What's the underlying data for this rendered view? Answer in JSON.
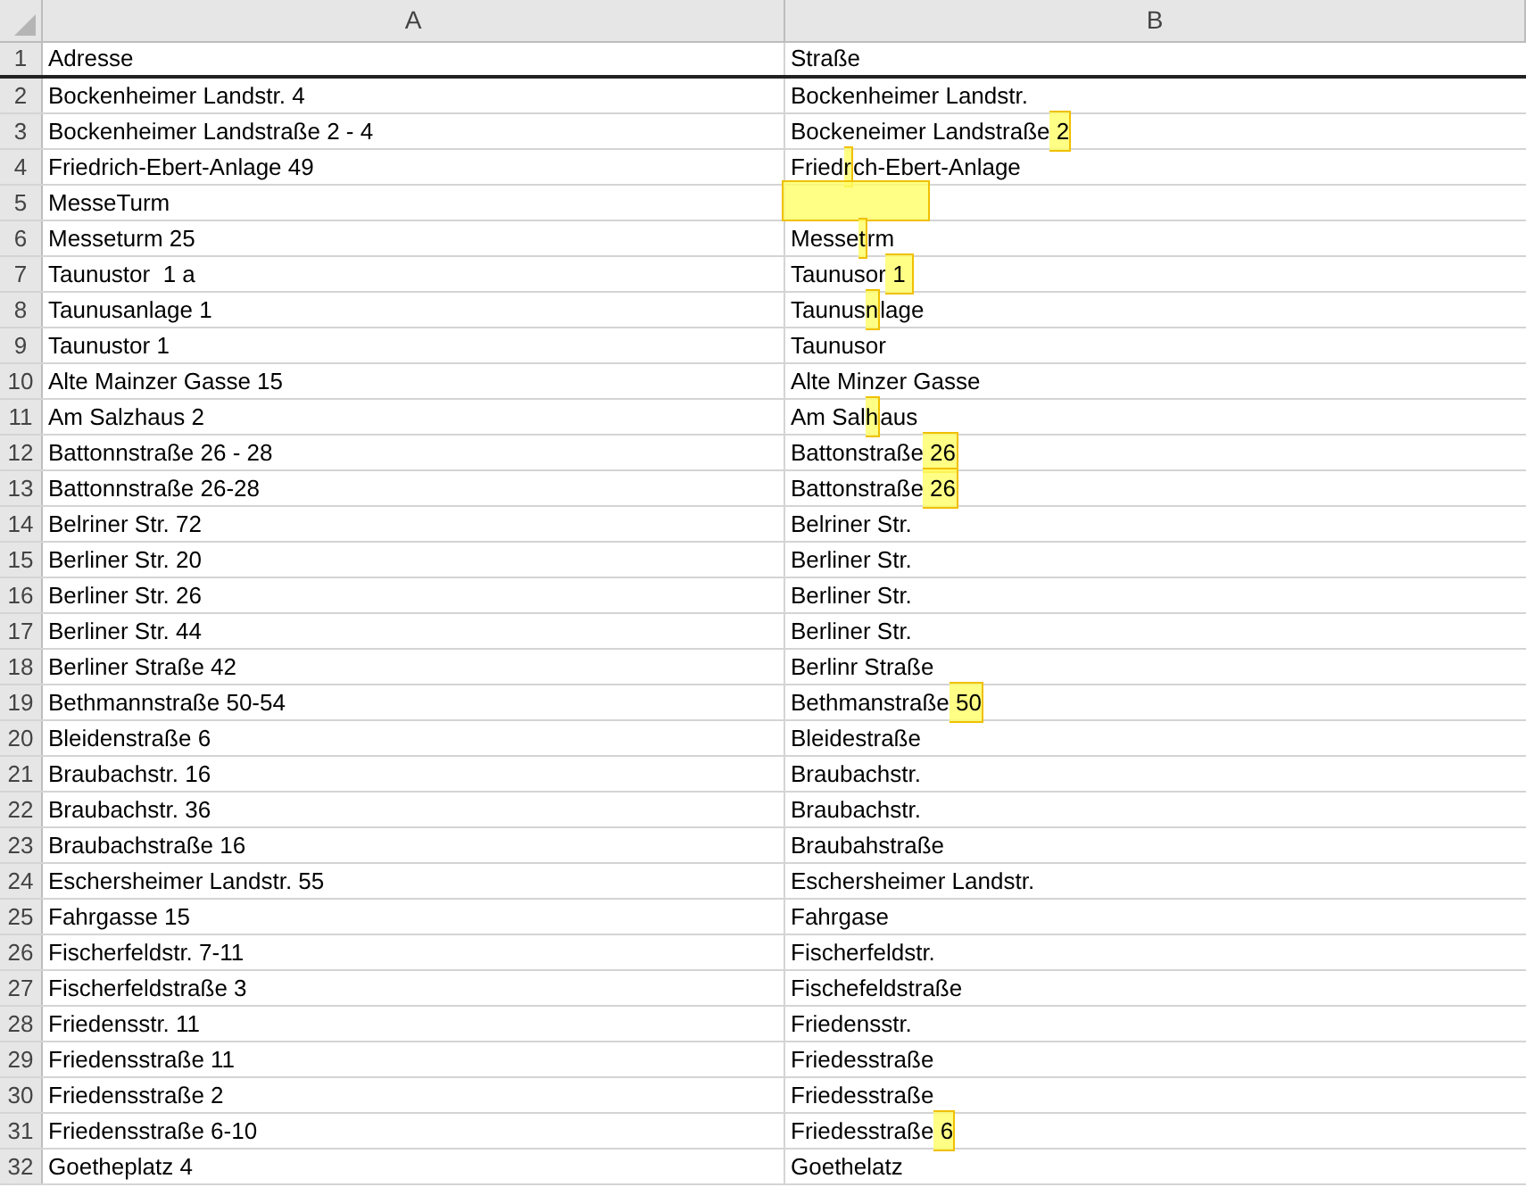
{
  "columns": [
    {
      "label": "A"
    },
    {
      "label": "B"
    }
  ],
  "rows": [
    {
      "n": "1",
      "a": "Adresse",
      "b": [
        {
          "text": "Straße",
          "highlight": false
        }
      ]
    },
    {
      "n": "2",
      "a": "Bockenheimer Landstr. 4",
      "b": [
        {
          "text": "Bockenheimer Landstr.",
          "highlight": false
        }
      ]
    },
    {
      "n": "3",
      "a": "Bockenheimer Landstraße 2 - 4",
      "b": [
        {
          "text": "Bockeneimer Landstraße",
          "highlight": false
        },
        {
          "text": " 2",
          "highlight": true
        }
      ]
    },
    {
      "n": "4",
      "a": "Friedrich-Ebert-Anlage 49",
      "b": [
        {
          "text": "Fried",
          "highlight": false
        },
        {
          "text": "r",
          "highlight": true
        },
        {
          "text": "ch-Ebert-Anlage",
          "highlight": false
        }
      ]
    },
    {
      "n": "5",
      "a": "MesseTurm",
      "b": [
        {
          "kind": "gap",
          "highlight": true
        }
      ]
    },
    {
      "n": "6",
      "a": "Messeturm 25",
      "b": [
        {
          "text": "Messe",
          "highlight": false
        },
        {
          "text": "t",
          "highlight": true
        },
        {
          "text": "rm",
          "highlight": false
        }
      ]
    },
    {
      "n": "7",
      "a": "Taunustor  1 a",
      "b": [
        {
          "text": "Taunusor",
          "highlight": false
        },
        {
          "text": " 1 ",
          "highlight": true
        }
      ]
    },
    {
      "n": "8",
      "a": "Taunusanlage 1",
      "b": [
        {
          "text": "Taunus",
          "highlight": false
        },
        {
          "text": "n",
          "highlight": true
        },
        {
          "text": "lage",
          "highlight": false
        }
      ]
    },
    {
      "n": "9",
      "a": "Taunustor 1",
      "b": [
        {
          "text": "Taunusor",
          "highlight": false
        }
      ]
    },
    {
      "n": "10",
      "a": "Alte Mainzer Gasse 15",
      "b": [
        {
          "text": "Alte Minzer Gasse",
          "highlight": false
        }
      ]
    },
    {
      "n": "11",
      "a": "Am Salzhaus 2",
      "b": [
        {
          "text": "Am Sal",
          "highlight": false
        },
        {
          "text": "h",
          "highlight": true
        },
        {
          "text": "aus",
          "highlight": false
        }
      ]
    },
    {
      "n": "12",
      "a": "Battonnstraße 26 - 28",
      "b": [
        {
          "text": "Battonstraße",
          "highlight": false
        },
        {
          "text": " 26",
          "highlight": true
        }
      ]
    },
    {
      "n": "13",
      "a": "Battonnstraße 26-28",
      "b": [
        {
          "text": "Battonstraße",
          "highlight": false
        },
        {
          "text": " 26",
          "highlight": true
        }
      ]
    },
    {
      "n": "14",
      "a": "Belriner Str. 72",
      "b": [
        {
          "text": "Belriner Str.",
          "highlight": false
        }
      ]
    },
    {
      "n": "15",
      "a": "Berliner Str. 20",
      "b": [
        {
          "text": "Berliner Str.",
          "highlight": false
        }
      ]
    },
    {
      "n": "16",
      "a": "Berliner Str. 26",
      "b": [
        {
          "text": "Berliner Str.",
          "highlight": false
        }
      ]
    },
    {
      "n": "17",
      "a": "Berliner Str. 44",
      "b": [
        {
          "text": "Berliner Str.",
          "highlight": false
        }
      ]
    },
    {
      "n": "18",
      "a": "Berliner Straße 42",
      "b": [
        {
          "text": "Berlinr Straße",
          "highlight": false
        }
      ]
    },
    {
      "n": "19",
      "a": "Bethmannstraße 50-54",
      "b": [
        {
          "text": "Bethmanstraße",
          "highlight": false
        },
        {
          "text": " 50",
          "highlight": true
        }
      ]
    },
    {
      "n": "20",
      "a": "Bleidenstraße 6",
      "b": [
        {
          "text": "Bleidestraße",
          "highlight": false
        }
      ]
    },
    {
      "n": "21",
      "a": "Braubachstr. 16",
      "b": [
        {
          "text": "Braubachstr.",
          "highlight": false
        }
      ]
    },
    {
      "n": "22",
      "a": "Braubachstr. 36",
      "b": [
        {
          "text": "Braubachstr.",
          "highlight": false
        }
      ]
    },
    {
      "n": "23",
      "a": "Braubachstraße 16",
      "b": [
        {
          "text": "Braubahstraße",
          "highlight": false
        }
      ]
    },
    {
      "n": "24",
      "a": "Eschersheimer Landstr. 55",
      "b": [
        {
          "text": "Eschersheimer Landstr.",
          "highlight": false
        }
      ]
    },
    {
      "n": "25",
      "a": "Fahrgasse 15",
      "b": [
        {
          "text": "Fahrgase",
          "highlight": false
        }
      ]
    },
    {
      "n": "26",
      "a": "Fischerfeldstr. 7-11",
      "b": [
        {
          "text": "Fischerfeldstr.",
          "highlight": false
        }
      ]
    },
    {
      "n": "27",
      "a": "Fischerfeldstraße 3",
      "b": [
        {
          "text": "Fischefeldstraße",
          "highlight": false
        }
      ]
    },
    {
      "n": "28",
      "a": "Friedensstr. 11",
      "b": [
        {
          "text": "Friedensstr.",
          "highlight": false
        }
      ]
    },
    {
      "n": "29",
      "a": "Friedensstraße 11",
      "b": [
        {
          "text": "Friedesstraße",
          "highlight": false
        }
      ]
    },
    {
      "n": "30",
      "a": "Friedensstraße 2",
      "b": [
        {
          "text": "Friedesstraße",
          "highlight": false
        }
      ]
    },
    {
      "n": "31",
      "a": "Friedensstraße 6-10",
      "b": [
        {
          "text": "Friedesstraße",
          "highlight": false
        },
        {
          "text": " 6",
          "highlight": true
        }
      ]
    },
    {
      "n": "32",
      "a": "Goetheplatz 4",
      "b": [
        {
          "text": "Goethelatz",
          "highlight": false
        }
      ]
    }
  ]
}
